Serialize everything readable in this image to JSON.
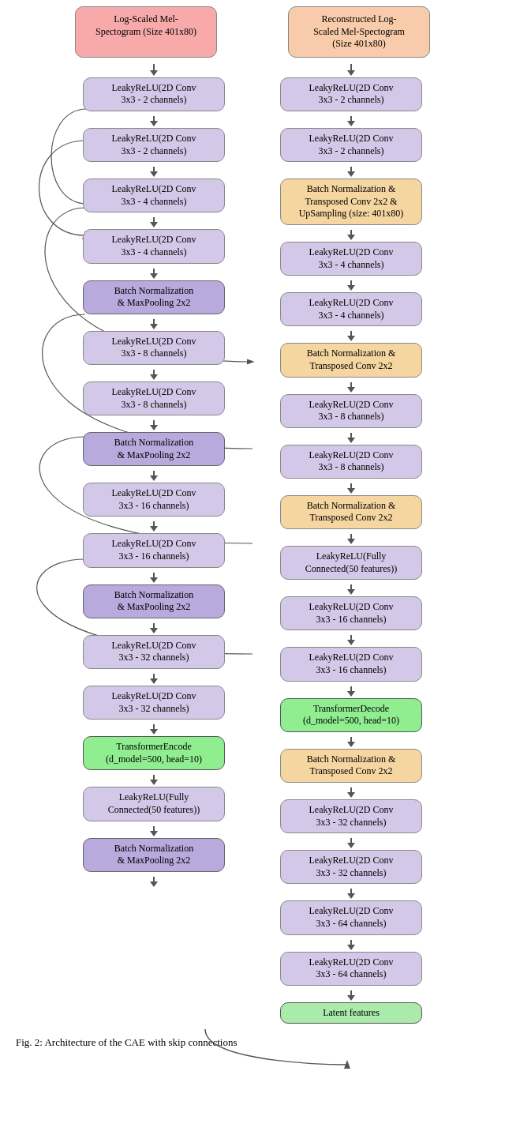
{
  "diagram": {
    "title_left": "Log-Scaled Mel-\nSpectogram (Size 401x80)",
    "title_right": "Reconstructed Log-\nScaled Mel-Spectogram\n(Size 401x80)",
    "left_nodes": [
      {
        "label": "LeakyReLU(2D Conv\n3x3 - 2 channels)",
        "type": "lavender"
      },
      {
        "label": "LeakyReLU(2D Conv\n3x3 - 2 channels)",
        "type": "lavender"
      },
      {
        "label": "LeakyReLU(2D Conv\n3x3 - 4 channels)",
        "type": "lavender"
      },
      {
        "label": "LeakyReLU(2D Conv\n3x3 - 4 channels)",
        "type": "lavender"
      },
      {
        "label": "Batch Normalization\n& MaxPooling 2x2",
        "type": "purple"
      },
      {
        "label": "LeakyReLU(2D Conv\n3x3 - 8 channels)",
        "type": "lavender"
      },
      {
        "label": "LeakyReLU(2D Conv\n3x3 - 8 channels)",
        "type": "lavender"
      },
      {
        "label": "Batch Normalization\n& MaxPooling 2x2",
        "type": "purple"
      },
      {
        "label": "LeakyReLU(2D Conv\n3x3 - 16 channels)",
        "type": "lavender"
      },
      {
        "label": "LeakyReLU(2D Conv\n3x3 - 16 channels)",
        "type": "lavender"
      },
      {
        "label": "Batch Normalization\n& MaxPooling 2x2",
        "type": "purple"
      },
      {
        "label": "LeakyReLU(2D Conv\n3x3 - 32 channels)",
        "type": "lavender"
      },
      {
        "label": "LeakyReLU(2D Conv\n3x3 - 32 channels)",
        "type": "lavender"
      },
      {
        "label": "TransformerEncode\n(d_model=500, head=10)",
        "type": "green"
      },
      {
        "label": "LeakyReLU(Fully\nConnected(50 features))",
        "type": "lavender"
      },
      {
        "label": "Batch Normalization\n& MaxPooling 2x2",
        "type": "purple"
      }
    ],
    "right_nodes": [
      {
        "label": "LeakyReLU(2D Conv\n3x3 - 2 channels)",
        "type": "lavender"
      },
      {
        "label": "LeakyReLU(2D Conv\n3x3 - 2 channels)",
        "type": "lavender"
      },
      {
        "label": "Batch Normalization &\nTransposed Conv 2x2 &\nUpSampling (size: 401x80)",
        "type": "orange"
      },
      {
        "label": "LeakyReLU(2D Conv\n3x3 - 4 channels)",
        "type": "lavender"
      },
      {
        "label": "LeakyReLU(2D Conv\n3x3 - 4 channels)",
        "type": "lavender"
      },
      {
        "label": "Batch Normalization &\nTransposed Conv 2x2",
        "type": "orange"
      },
      {
        "label": "LeakyReLU(2D Conv\n3x3 - 8 channels)",
        "type": "lavender"
      },
      {
        "label": "LeakyReLU(2D Conv\n3x3 - 8 channels)",
        "type": "lavender"
      },
      {
        "label": "Batch Normalization &\nTransposed Conv 2x2",
        "type": "orange"
      },
      {
        "label": "LeakyReLU(Fully\nConnected(50 features))",
        "type": "lavender"
      },
      {
        "label": "LeakyReLU(2D Conv\n3x3 - 16 channels)",
        "type": "lavender"
      },
      {
        "label": "LeakyReLU(2D Conv\n3x3 - 16 channels)",
        "type": "lavender"
      },
      {
        "label": "TransformerDecode\n(d_model=500, head=10)",
        "type": "green"
      },
      {
        "label": "Batch Normalization &\nTransposed Conv 2x2",
        "type": "orange"
      },
      {
        "label": "LeakyReLU(2D Conv\n3x3 - 32 channels)",
        "type": "lavender"
      },
      {
        "label": "LeakyReLU(2D Conv\n3x3 - 32 channels)",
        "type": "lavender"
      },
      {
        "label": "LeakyReLU(2D Conv\n3x3 - 64 channels)",
        "type": "lavender"
      },
      {
        "label": "LeakyReLU(2D Conv\n3x3 - 64 channels)",
        "type": "lavender"
      },
      {
        "label": "Latent features",
        "type": "green-light"
      }
    ],
    "caption": "Fig. 2: Architecture of the CAE with skip connections"
  }
}
